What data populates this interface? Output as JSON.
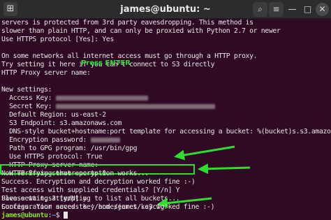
{
  "window": {
    "title": "james@ubuntu: ~",
    "buttons": {
      "new_tab": "⊞",
      "search": "⌕",
      "menu": "≡",
      "minimize": "—",
      "maximize": "□",
      "close": "✕"
    }
  },
  "terminal": {
    "lines": [
      "servers is protected from 3rd party eavesdropping. This method is",
      "slower than plain HTTP, and can only be proxied with Python 2.7 or newer",
      "Use HTTPS protocol [Yes]: Yes",
      "",
      "On some networks all internet access must go through a HTTP proxy.",
      "Try setting it here if you can't connect to S3 directly",
      "HTTP Proxy server name:",
      "",
      "New settings:",
      "  Access Key: ",
      "  Secret Key: ",
      "  Default Region: us-east-2",
      "  S3 Endpoint: s3.amazonaws.com",
      "  DNS-style bucket+hostname:port template for accessing a bucket: %(bucket)s.s3.amazonaws.com",
      "  Encryption password: ",
      "  Path to GPG program: /usr/bin/gpg",
      "  Use HTTPS protocol: True",
      "  HTTP Proxy server name:",
      "  HTTP Proxy server port: 0",
      "",
      "Test access with supplied credentials? [Y/n] Y",
      "Please wait, attempting to list all buckets...",
      "Success. Your access key and secret key worked fine :-)",
      "",
      "Now verifying that encryption works...",
      "Success. Encryption and decryption worked fine :-)",
      "",
      "Save settings? [y/N] y",
      "Configuration saved to '/home/james/.s3cfg'"
    ],
    "prompt": {
      "user": "james@ubuntu",
      "sep": ":",
      "path": "~",
      "symbol": "$ "
    }
  },
  "annotations": {
    "press_enter": "Press ENTER"
  },
  "colors": {
    "background": "#300a24",
    "text": "#e6e6e6",
    "annotation": "#2fdc2f",
    "prompt_user": "#8ae234",
    "prompt_path": "#729fcf"
  }
}
